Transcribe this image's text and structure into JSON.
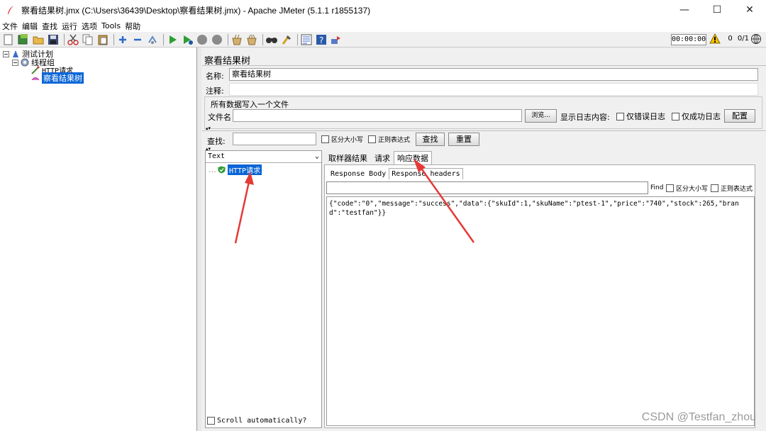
{
  "window": {
    "title": "察看结果树.jmx (C:\\Users\\36439\\Desktop\\察看结果树.jmx) - Apache JMeter (5.1.1 r1855137)",
    "minimize": "—",
    "maximize": "☐",
    "close": "✕"
  },
  "menu": [
    "文件",
    "编辑",
    "查找",
    "运行",
    "选项",
    "Tools",
    "帮助"
  ],
  "toolbar": {
    "timer": "00:00:00",
    "warnings": "0",
    "threads": "0/1",
    "icons": [
      "new-icon",
      "template-icon",
      "open-icon",
      "save-icon",
      "cut-icon",
      "copy-icon",
      "paste-icon",
      "expand-icon",
      "collapse-icon",
      "toggle-icon",
      "start-icon",
      "start-no-pause-icon",
      "stop-icon",
      "shutdown-icon",
      "clear-icon",
      "clear-all-icon",
      "search-icon",
      "reset-search-icon",
      "function-helper-icon",
      "help-icon",
      "remote-icon"
    ]
  },
  "tree": {
    "items": [
      {
        "label": "测试计划",
        "icon": "test-plan-icon"
      },
      {
        "label": "线程组",
        "icon": "thread-group-icon"
      },
      {
        "label": "HTTP请求",
        "icon": "http-sampler-icon"
      },
      {
        "label": "察看结果树",
        "icon": "listener-icon",
        "selected": true
      }
    ]
  },
  "panel": {
    "title": "察看结果树",
    "name_label": "名称:",
    "name_value": "察看结果树",
    "comment_label": "注释:",
    "comment_value": "",
    "file_group_title": "所有数据写入一个文件",
    "filename_label": "文件名",
    "filename_value": "",
    "browse_label": "浏览...",
    "log_label": "显示日志内容:",
    "errors_only": "仅错误日志",
    "success_only": "仅成功日志",
    "config_label": "配置"
  },
  "search": {
    "label": "查找:",
    "value": "",
    "case_sensitive": "区分大小写",
    "regex": "正则表达式",
    "find_button": "查找",
    "reset_button": "重置"
  },
  "results": {
    "renderer": "Text",
    "items": [
      {
        "label": "HTTP请求",
        "status": "success"
      }
    ],
    "scroll_auto": "Scroll automatically?"
  },
  "tabs": [
    "取样器结果",
    "请求",
    "响应数据"
  ],
  "subtabs": [
    "Response Body",
    "Response headers"
  ],
  "find": {
    "label": "Find",
    "case_sensitive": "区分大小写",
    "regex": "正则表达式"
  },
  "response_body": "{\"code\":\"0\",\"message\":\"success\",\"data\":{\"skuId\":1,\"skuName\":\"ptest-1\",\"price\":\"740\",\"stock\":265,\"brand\":\"testfan\"}}",
  "watermark": "CSDN @Testfan_zhou",
  "colors": {
    "selection": "#0b65d6",
    "annotation_arrow": "#e53935",
    "success": "#2e9d34"
  }
}
